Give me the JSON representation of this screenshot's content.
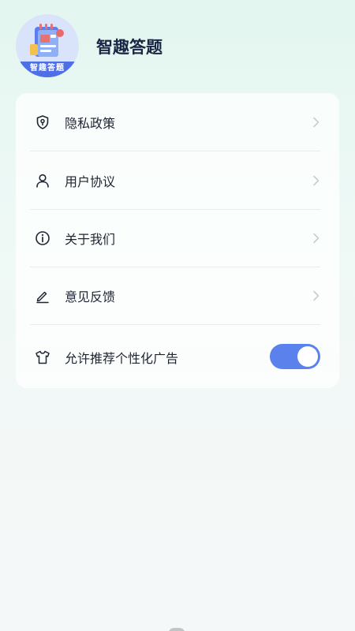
{
  "app": {
    "name": "智趣答题",
    "logo_caption": "智趣答题",
    "logo_icon": "notebook-icon"
  },
  "menu": {
    "items": [
      {
        "label": "隐私政策",
        "icon": "shield-icon"
      },
      {
        "label": "用户协议",
        "icon": "user-icon"
      },
      {
        "label": "关于我们",
        "icon": "info-icon"
      },
      {
        "label": "意见反馈",
        "icon": "pen-icon"
      }
    ],
    "toggle_item": {
      "label": "允许推荐个性化广告",
      "icon": "shirt-icon",
      "enabled": true
    }
  },
  "colors": {
    "accent": "#5b82ec",
    "title": "#1a2744",
    "logo_bg": "#d9e4fb",
    "logo_band": "#4f6fe6"
  }
}
